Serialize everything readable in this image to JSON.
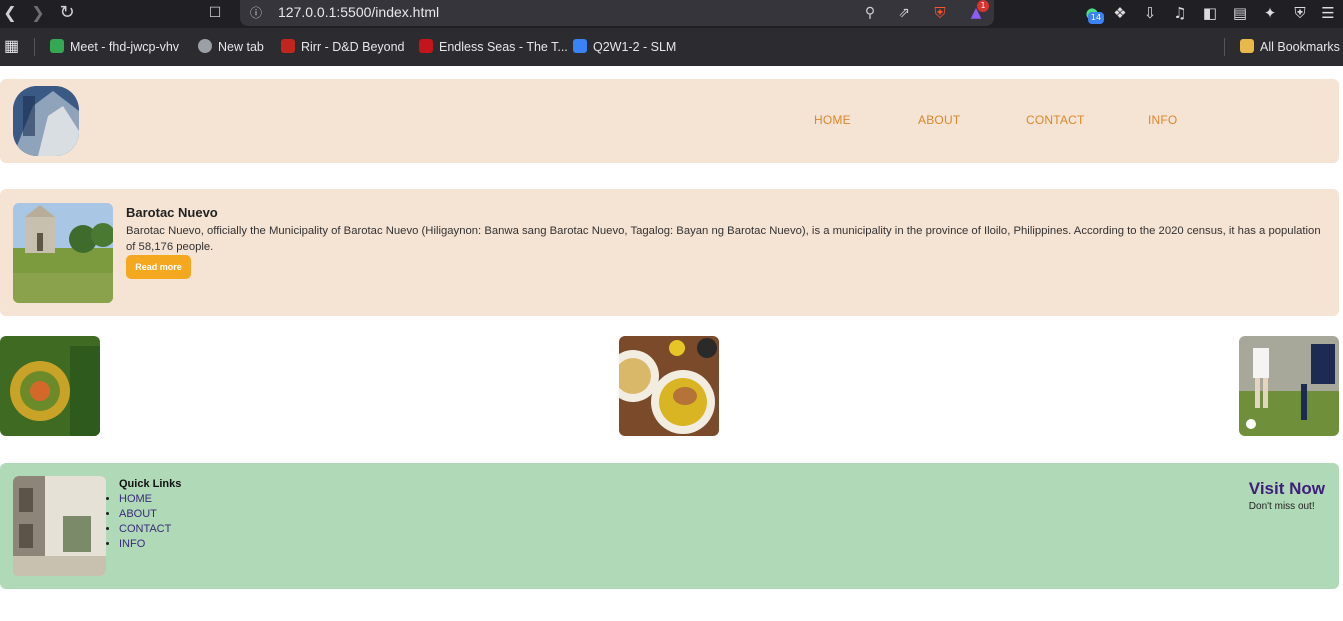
{
  "browser": {
    "url": "127.0.0.1:5500/index.html",
    "ext_badge_count": "14",
    "notif_badge_count": "1",
    "bookmarks": [
      {
        "label": "Meet - fhd-jwcp-vhv",
        "icon": "google-meet-icon",
        "color": "#34a853"
      },
      {
        "label": "New tab",
        "icon": "globe-icon",
        "color": "#9aa0a6"
      },
      {
        "label": "Rirr - D&D Beyond",
        "icon": "dnd-beyond-icon",
        "color": "#c0261d"
      },
      {
        "label": "Endless Seas - The T...",
        "icon": "b-logo-icon",
        "color": "#c4141c"
      },
      {
        "label": "Q2W1-2 - SLM",
        "icon": "classroom-icon",
        "color": "#3b82f6"
      }
    ],
    "all_bookmarks_label": "All Bookmarks"
  },
  "header": {
    "nav": [
      "HOME",
      "ABOUT",
      "CONTACT",
      "INFO"
    ]
  },
  "feature": {
    "title": "Barotac Nuevo",
    "text": "Barotac Nuevo, officially the Municipality of Barotac Nuevo (Hiligaynon: Banwa sang Barotac Nuevo, Tagalog: Bayan ng Barotac Nuevo), is a municipality in the province of Iloilo, Philippines. According to the 2020 census, it has a population of 58,176 people.",
    "button": "Read more"
  },
  "footer": {
    "quick_links_title": "Quick Links",
    "links": [
      "HOME",
      "ABOUT",
      "CONTACT",
      "INFO"
    ],
    "visit_title": "Visit Now",
    "visit_sub": "Don't miss out!"
  },
  "colors": {
    "header_bg": "#f5e3d4",
    "nav_link": "#d9882c",
    "button": "#f4a820",
    "footer_bg": "#b0d9b7",
    "visit_title": "#3d1f7a"
  }
}
